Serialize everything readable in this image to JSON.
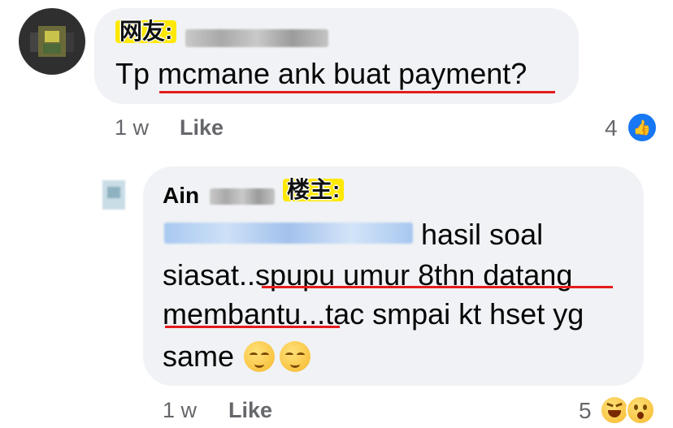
{
  "comment1": {
    "label_tag": "网友:",
    "text": "Tp mcmane ank buat payment?",
    "time": "1 w",
    "like_label": "Like",
    "reaction_count": "4",
    "reaction_icon": "thumbs-up-icon",
    "reaction_color": "#1877f2"
  },
  "comment2": {
    "author": "Ain",
    "label_tag": "楼主:",
    "line1_tail": "hasil soal",
    "line2": "siasat..spupu umur 8thn datang",
    "line3": "membantu...tac smpai kt hset yg",
    "line4": "same",
    "time": "1 w",
    "like_label": "Like",
    "reaction_count": "5",
    "reaction_icons": [
      "laughing-face-icon",
      "surprised-face-icon"
    ]
  },
  "colors": {
    "bubble": "#f0f2f5",
    "underline": "#e51c1c",
    "tag_bg": "#ffe800",
    "meta": "#65676b"
  }
}
